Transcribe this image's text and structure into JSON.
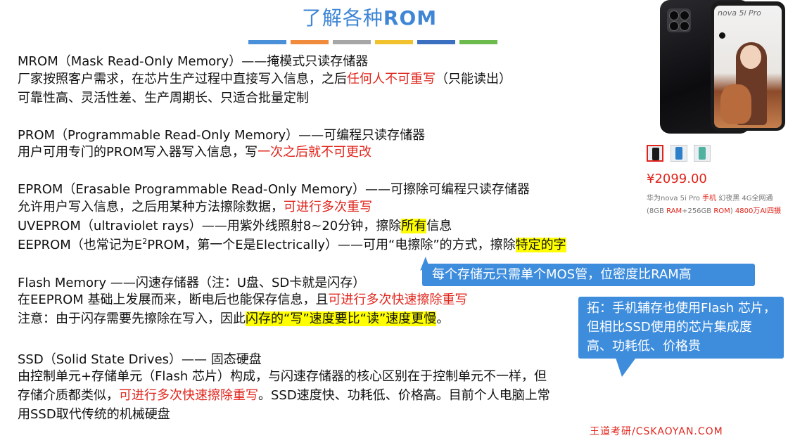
{
  "title": {
    "prefix": "了解各种",
    "rom": "ROM"
  },
  "divider_colors": [
    "#4a90d9",
    "#f08a3c",
    "#a6a6a6",
    "#f2c12e",
    "#3b6fc0",
    "#6dbb4e"
  ],
  "mrom": {
    "heading": "MROM（Mask Read-Only Memory）——掩模式只读存储器",
    "line1_a": "厂家按照客户需求，在芯片生产过程中直接写入信息，之后",
    "line1_red": "任何人不可重写",
    "line1_b": "（只能读出）",
    "line2": "可靠性高、灵活性差、生产周期长、只适合批量定制"
  },
  "prom": {
    "heading": "PROM（Programmable Read-Only Memory）——可编程只读存储器",
    "line1_a": "用户可用专门的PROM写入器写入信息，写",
    "line1_red": "一次之后就不可更改"
  },
  "eprom": {
    "heading": "EPROM（Erasable Programmable Read-Only Memory）——可擦除可编程只读存储器",
    "line1_a": "允许用户写入信息，之后用某种方法擦除数据，",
    "line1_red": "可进行多次重写",
    "uv_a": "UVEPROM（ultraviolet rays）——用紫外线照射8~20分钟，擦除",
    "uv_hl": "所有",
    "uv_b": "信息",
    "ee_a": "EEPROM（也常记为E",
    "ee_sup": "2",
    "ee_b": "PROM，第一个E是Electrically）——可用“电擦除”的方式，擦除",
    "ee_hl": "特定的字"
  },
  "flash": {
    "heading": "Flash Memory ——闪速存储器（注：U盘、SD卡就是闪存）",
    "line1_a": "在EEPROM 基础上发展而来，断电后也能保存信息，且",
    "line1_red": "可进行多次快速擦除重写",
    "line2_a": "注意：由于闪存需要先擦除在写入，因此",
    "line2_hl": "闪存的“写”速度要比“读”速度更慢",
    "line2_b": "。"
  },
  "ssd": {
    "heading": "SSD（Solid State Drives）—— 固态硬盘",
    "line1": "由控制单元+存储单元（Flash 芯片）构成，与闪速存储器的核心区别在于控制单元不一样，但",
    "line2_a": "存储介质都类似，",
    "line2_red": "可进行多次快速擦除重写",
    "line2_b": "。SSD速度快、功耗低、价格高。目前个人电脑上常",
    "line3": "用SSD取代传统的机械硬盘"
  },
  "callouts": {
    "mos": "每个存储元只需单个MOS管，位密度比RAM高",
    "phone_note": "拓：手机辅存也使用Flash 芯片，但相比SSD使用的芯片集成度高、功耗低、价格贵"
  },
  "product": {
    "brand": "nova 5i Pro",
    "price": "¥2099.00",
    "desc1_a": "华为nova 5i Pro ",
    "desc1_red": "手机",
    "desc1_b": " 幻夜黑 4G全网通",
    "desc2_a": "(8GB ",
    "desc2_r1": "RAM",
    "desc2_b": "+256GB ",
    "desc2_r2": "ROM",
    "desc2_c": ") ",
    "desc2_r3": "4800万AI四摄",
    "thumb_colors": [
      "#1a1a1a",
      "#2e7fc9",
      "#4fb2a0"
    ]
  },
  "watermark": "王道考研/CSKAOYAN.COM"
}
